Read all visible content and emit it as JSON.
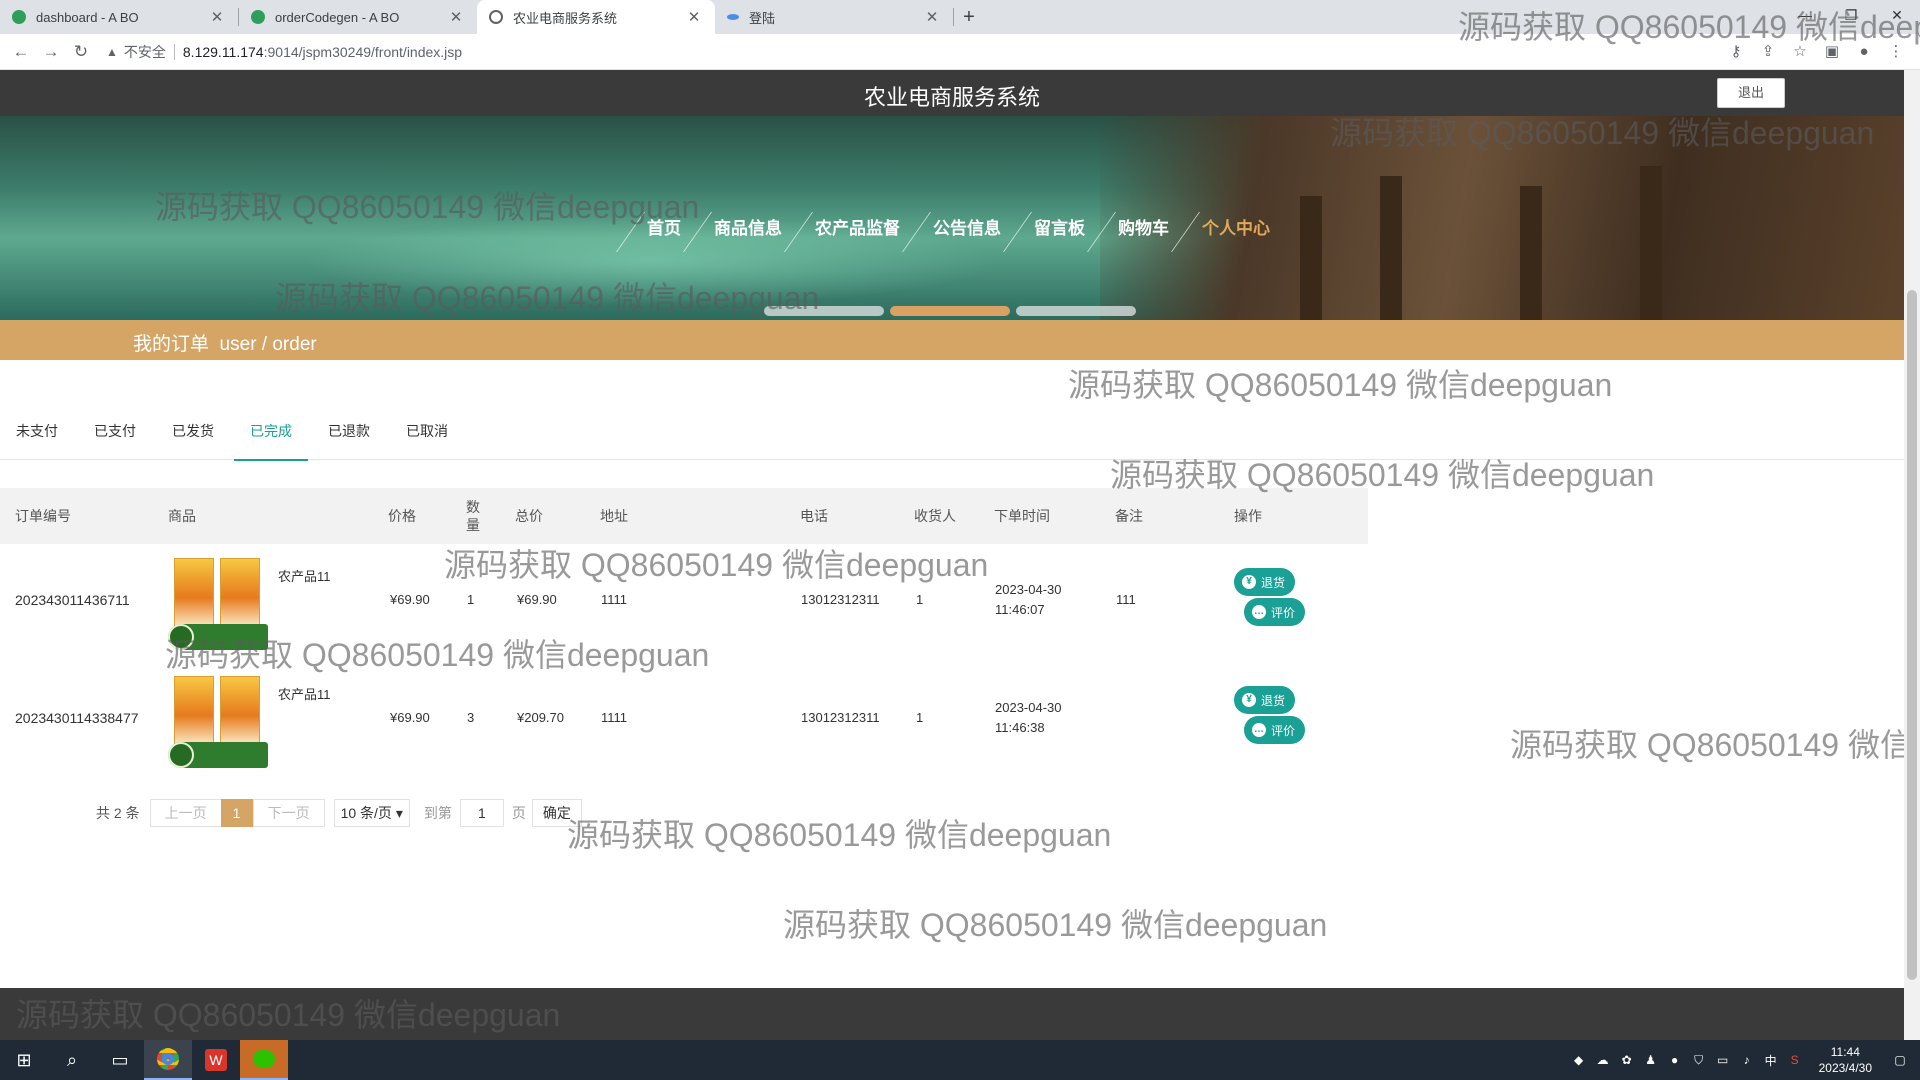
{
  "browser": {
    "tabs": [
      {
        "title": "dashboard - A BO",
        "active": false,
        "fav_color": "#2e9f5a"
      },
      {
        "title": "orderCodegen - A BO",
        "active": false,
        "fav_color": "#2e9f5a"
      },
      {
        "title": "农业电商服务系统",
        "active": true,
        "fav_color": "#5f6368"
      },
      {
        "title": "登陆",
        "active": false,
        "fav_color": "#4a90e2"
      }
    ],
    "address": {
      "security_label": "不安全",
      "url_host": "8.129.11.174",
      "url_rest": ":9014/jspm30249/front/index.jsp"
    }
  },
  "site": {
    "title": "农业电商服务系统",
    "logout_label": "退出",
    "nav": [
      {
        "label": "首页",
        "active": false
      },
      {
        "label": "商品信息",
        "active": false
      },
      {
        "label": "农产品监督",
        "active": false
      },
      {
        "label": "公告信息",
        "active": false
      },
      {
        "label": "留言板",
        "active": false
      },
      {
        "label": "购物车",
        "active": false
      },
      {
        "label": "个人中心",
        "active": true
      }
    ],
    "carousel_active_index": 1,
    "breadcrumb": "我的订单  user / order"
  },
  "order_tabs": [
    {
      "label": "未支付",
      "active": false
    },
    {
      "label": "已支付",
      "active": false
    },
    {
      "label": "已发货",
      "active": false
    },
    {
      "label": "已完成",
      "active": true
    },
    {
      "label": "已退款",
      "active": false
    },
    {
      "label": "已取消",
      "active": false
    }
  ],
  "table": {
    "headers": {
      "order_no": "订单编号",
      "product": "商品",
      "price": "价格",
      "qty": "数量",
      "total": "总价",
      "address": "地址",
      "phone": "电话",
      "receiver": "收货人",
      "time": "下单时间",
      "remark": "备注",
      "ops": "操作"
    },
    "rows": [
      {
        "order_no": "202343011436711",
        "product_name": "农产品11",
        "price": "¥69.90",
        "qty": "1",
        "total": "¥69.90",
        "address": "1111",
        "phone": "13012312311",
        "receiver": "1",
        "time_date": "2023-04-30",
        "time_clock": "11:46:07",
        "remark": "111",
        "refund_label": "退货",
        "review_label": "评价"
      },
      {
        "order_no": "2023430114338477",
        "product_name": "农产品11",
        "price": "¥69.90",
        "qty": "3",
        "total": "¥209.70",
        "address": "1111",
        "phone": "13012312311",
        "receiver": "1",
        "time_date": "2023-04-30",
        "time_clock": "11:46:38",
        "remark": "",
        "refund_label": "退货",
        "review_label": "评价"
      }
    ]
  },
  "pager": {
    "total": "共 2 条",
    "prev": "上一页",
    "current": "1",
    "next": "下一页",
    "page_size": "10 条/页",
    "goto": "到第",
    "goto_value": "1",
    "page_unit": "页",
    "confirm": "确定"
  },
  "watermark_text": "源码获取 QQ86050149 微信deepguan",
  "watermark_cut_1": "源码获取 QQ86050149 微信deep",
  "watermark_cut_2": "源码获取 QQ86050149 微信d",
  "taskbar": {
    "ime": "中",
    "time": "11:44",
    "date": "2023/4/30"
  },
  "colors": {
    "accent_gold": "#d4a564",
    "accent_teal": "#1aa094",
    "header_dark": "#3a3a3a"
  }
}
